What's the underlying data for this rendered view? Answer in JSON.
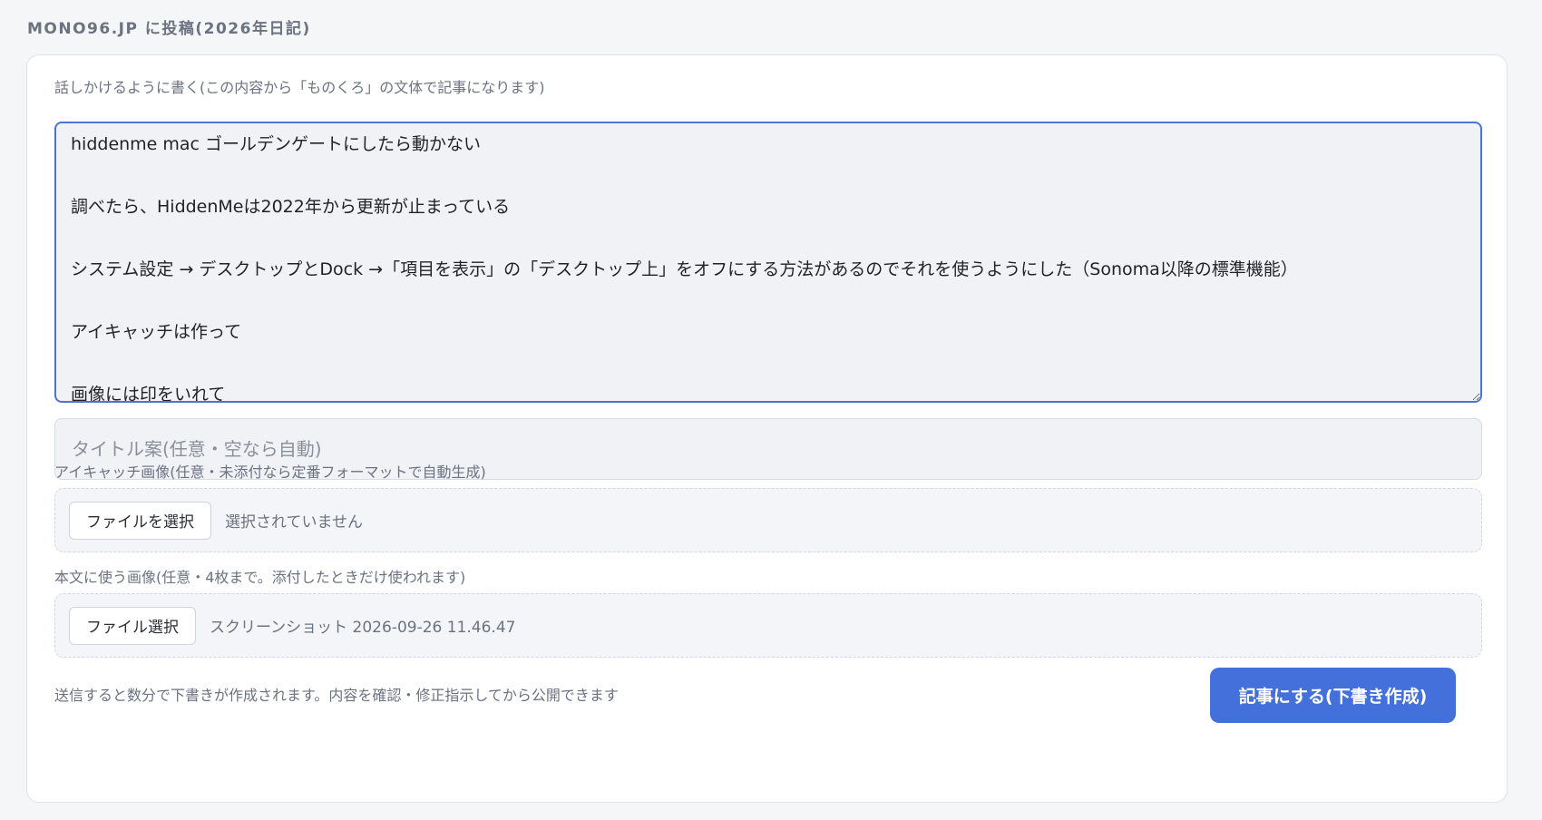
{
  "page": {
    "heading": "MONO96.JP に投稿(2026年日記)"
  },
  "form": {
    "body_label": "話しかけるように書く(この内容から「ものくろ」の文体で記事になります)",
    "body_value": "hiddenme mac ゴールデンゲートにしたら動かない\n\n調べたら、HiddenMeは2022年から更新が止まっている\n\nシステム設定 → デスクトップとDock →「項目を表示」の「デスクトップ上」をオフにする方法があるのでそれを使うようにした（Sonoma以降の標準機能）\n\nアイキャッチは作って\n\n画像には印をいれて",
    "title_placeholder": "タイトル案(任意・空なら自動)",
    "eyecatch_label": "アイキャッチ画像(任意・未添付なら定番フォーマットで自動生成)",
    "eyecatch_button": "ファイルを選択",
    "eyecatch_status": "選択されていません",
    "body_images_label": "本文に使う画像(任意・4枚まで。添付したときだけ使われます)",
    "body_images_button": "ファイル選択",
    "body_images_status": "スクリーンショット 2026-09-26 11.46.47",
    "note": "送信すると数分で下書きが作成されます。内容を確認・修正指示してから公開できます",
    "submit_label": "記事にする(下書き作成)"
  },
  "colors": {
    "accent": "#4470dc",
    "focus_border": "#4a74d6",
    "field_bg": "#f0f2f6"
  }
}
